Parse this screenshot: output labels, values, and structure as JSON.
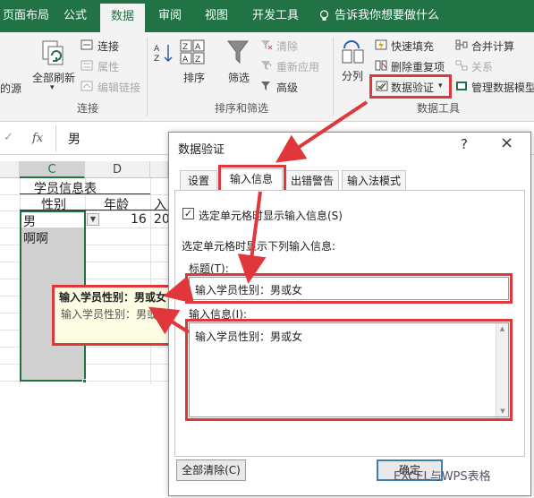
{
  "ribbon_tabs": [
    "页面布局",
    "公式",
    "数据",
    "审阅",
    "视图",
    "开发工具"
  ],
  "active_tab": "数据",
  "tell_me": "告诉我你想要做什么",
  "ribbon": {
    "refresh_all": "全部刷新",
    "connections": "连接",
    "properties": "属性",
    "edit_links": "编辑链接",
    "data_source_fragment": "的源",
    "sort": "排序",
    "filter": "筛选",
    "clear": "清除",
    "reapply": "重新应用",
    "advanced": "高级",
    "split": "分列",
    "flash_fill": "快速填充",
    "remove_duplicates": "删除重复项",
    "data_validation": "数据验证",
    "consolidate": "合并计算",
    "relationships": "关系",
    "manage_data_model": "管理数据模型",
    "group_connections": "连接",
    "group_sort_filter": "排序和筛选",
    "group_data_tools": "数据工具"
  },
  "formula_bar": {
    "fx": "fx",
    "value": "男"
  },
  "sheet": {
    "columns": [
      "C",
      "D"
    ],
    "table_title": "学员信息表",
    "header_gender": "性别",
    "header_age": "年龄",
    "header_partial": "入",
    "row1_gender": "男",
    "row1_age": "16",
    "row1_partial": "20",
    "row2_gender": "啊啊"
  },
  "tooltip": {
    "title": "输入学员性别：男或女",
    "body": "输入学员性别：男或女"
  },
  "dialog": {
    "title": "数据验证",
    "help": "?",
    "close": "×",
    "tabs": [
      "设置",
      "输入信息",
      "出错警告",
      "输入法模式"
    ],
    "active_tab": "输入信息",
    "checkbox_label": "选定单元格时显示输入信息(S)",
    "checkbox_checked": true,
    "group_label": "选定单元格时显示下列输入信息:",
    "title_label": "标题(T):",
    "title_value": "输入学员性别：男或女",
    "message_label": "输入信息(I):",
    "message_value": "输入学员性别：男或女",
    "clear_all": "全部清除(C)",
    "ok": "确定"
  },
  "watermark": "EXCEL与WPS表格",
  "colors": {
    "excel_green": "#217346",
    "highlight_red": "#e0373b",
    "tooltip_bg": "#fdfde4"
  }
}
